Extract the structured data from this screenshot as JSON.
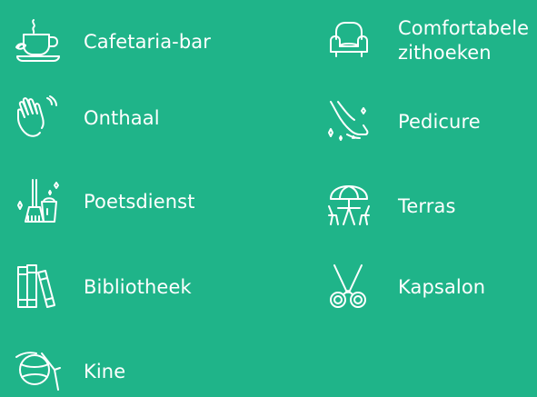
{
  "colors": {
    "background": "#1fb489",
    "foreground": "#ffffff"
  },
  "facilities": {
    "left": [
      {
        "label": "Cafetaria-bar",
        "icon": "coffee-cup-icon"
      },
      {
        "label": "Onthaal",
        "icon": "waving-hand-icon"
      },
      {
        "label": "Poetsdienst",
        "icon": "cleaning-bucket-icon"
      },
      {
        "label": "Bibliotheek",
        "icon": "books-icon"
      },
      {
        "label": "Kine",
        "icon": "exercise-ball-icon"
      }
    ],
    "right": [
      {
        "label": "Comfortabele\nzithoeken",
        "icon": "armchair-icon"
      },
      {
        "label": "Pedicure",
        "icon": "foot-icon"
      },
      {
        "label": "Terras",
        "icon": "patio-table-umbrella-icon"
      },
      {
        "label": "Kapsalon",
        "icon": "scissors-icon"
      }
    ]
  }
}
